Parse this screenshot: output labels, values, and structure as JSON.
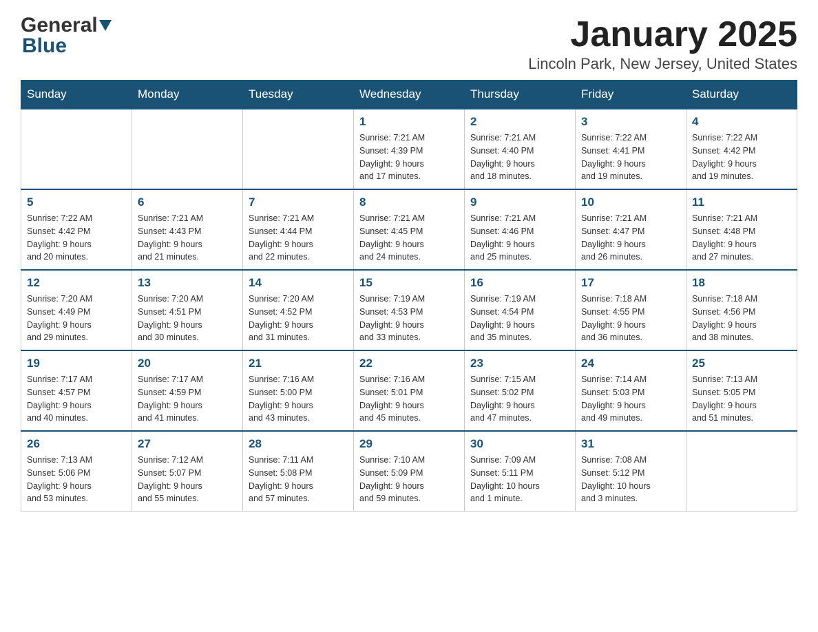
{
  "header": {
    "logo_general": "General",
    "logo_blue": "Blue",
    "month_title": "January 2025",
    "location": "Lincoln Park, New Jersey, United States"
  },
  "days_of_week": [
    "Sunday",
    "Monday",
    "Tuesday",
    "Wednesday",
    "Thursday",
    "Friday",
    "Saturday"
  ],
  "weeks": [
    [
      {
        "day": "",
        "info": ""
      },
      {
        "day": "",
        "info": ""
      },
      {
        "day": "",
        "info": ""
      },
      {
        "day": "1",
        "info": "Sunrise: 7:21 AM\nSunset: 4:39 PM\nDaylight: 9 hours\nand 17 minutes."
      },
      {
        "day": "2",
        "info": "Sunrise: 7:21 AM\nSunset: 4:40 PM\nDaylight: 9 hours\nand 18 minutes."
      },
      {
        "day": "3",
        "info": "Sunrise: 7:22 AM\nSunset: 4:41 PM\nDaylight: 9 hours\nand 19 minutes."
      },
      {
        "day": "4",
        "info": "Sunrise: 7:22 AM\nSunset: 4:42 PM\nDaylight: 9 hours\nand 19 minutes."
      }
    ],
    [
      {
        "day": "5",
        "info": "Sunrise: 7:22 AM\nSunset: 4:42 PM\nDaylight: 9 hours\nand 20 minutes."
      },
      {
        "day": "6",
        "info": "Sunrise: 7:21 AM\nSunset: 4:43 PM\nDaylight: 9 hours\nand 21 minutes."
      },
      {
        "day": "7",
        "info": "Sunrise: 7:21 AM\nSunset: 4:44 PM\nDaylight: 9 hours\nand 22 minutes."
      },
      {
        "day": "8",
        "info": "Sunrise: 7:21 AM\nSunset: 4:45 PM\nDaylight: 9 hours\nand 24 minutes."
      },
      {
        "day": "9",
        "info": "Sunrise: 7:21 AM\nSunset: 4:46 PM\nDaylight: 9 hours\nand 25 minutes."
      },
      {
        "day": "10",
        "info": "Sunrise: 7:21 AM\nSunset: 4:47 PM\nDaylight: 9 hours\nand 26 minutes."
      },
      {
        "day": "11",
        "info": "Sunrise: 7:21 AM\nSunset: 4:48 PM\nDaylight: 9 hours\nand 27 minutes."
      }
    ],
    [
      {
        "day": "12",
        "info": "Sunrise: 7:20 AM\nSunset: 4:49 PM\nDaylight: 9 hours\nand 29 minutes."
      },
      {
        "day": "13",
        "info": "Sunrise: 7:20 AM\nSunset: 4:51 PM\nDaylight: 9 hours\nand 30 minutes."
      },
      {
        "day": "14",
        "info": "Sunrise: 7:20 AM\nSunset: 4:52 PM\nDaylight: 9 hours\nand 31 minutes."
      },
      {
        "day": "15",
        "info": "Sunrise: 7:19 AM\nSunset: 4:53 PM\nDaylight: 9 hours\nand 33 minutes."
      },
      {
        "day": "16",
        "info": "Sunrise: 7:19 AM\nSunset: 4:54 PM\nDaylight: 9 hours\nand 35 minutes."
      },
      {
        "day": "17",
        "info": "Sunrise: 7:18 AM\nSunset: 4:55 PM\nDaylight: 9 hours\nand 36 minutes."
      },
      {
        "day": "18",
        "info": "Sunrise: 7:18 AM\nSunset: 4:56 PM\nDaylight: 9 hours\nand 38 minutes."
      }
    ],
    [
      {
        "day": "19",
        "info": "Sunrise: 7:17 AM\nSunset: 4:57 PM\nDaylight: 9 hours\nand 40 minutes."
      },
      {
        "day": "20",
        "info": "Sunrise: 7:17 AM\nSunset: 4:59 PM\nDaylight: 9 hours\nand 41 minutes."
      },
      {
        "day": "21",
        "info": "Sunrise: 7:16 AM\nSunset: 5:00 PM\nDaylight: 9 hours\nand 43 minutes."
      },
      {
        "day": "22",
        "info": "Sunrise: 7:16 AM\nSunset: 5:01 PM\nDaylight: 9 hours\nand 45 minutes."
      },
      {
        "day": "23",
        "info": "Sunrise: 7:15 AM\nSunset: 5:02 PM\nDaylight: 9 hours\nand 47 minutes."
      },
      {
        "day": "24",
        "info": "Sunrise: 7:14 AM\nSunset: 5:03 PM\nDaylight: 9 hours\nand 49 minutes."
      },
      {
        "day": "25",
        "info": "Sunrise: 7:13 AM\nSunset: 5:05 PM\nDaylight: 9 hours\nand 51 minutes."
      }
    ],
    [
      {
        "day": "26",
        "info": "Sunrise: 7:13 AM\nSunset: 5:06 PM\nDaylight: 9 hours\nand 53 minutes."
      },
      {
        "day": "27",
        "info": "Sunrise: 7:12 AM\nSunset: 5:07 PM\nDaylight: 9 hours\nand 55 minutes."
      },
      {
        "day": "28",
        "info": "Sunrise: 7:11 AM\nSunset: 5:08 PM\nDaylight: 9 hours\nand 57 minutes."
      },
      {
        "day": "29",
        "info": "Sunrise: 7:10 AM\nSunset: 5:09 PM\nDaylight: 9 hours\nand 59 minutes."
      },
      {
        "day": "30",
        "info": "Sunrise: 7:09 AM\nSunset: 5:11 PM\nDaylight: 10 hours\nand 1 minute."
      },
      {
        "day": "31",
        "info": "Sunrise: 7:08 AM\nSunset: 5:12 PM\nDaylight: 10 hours\nand 3 minutes."
      },
      {
        "day": "",
        "info": ""
      }
    ]
  ]
}
